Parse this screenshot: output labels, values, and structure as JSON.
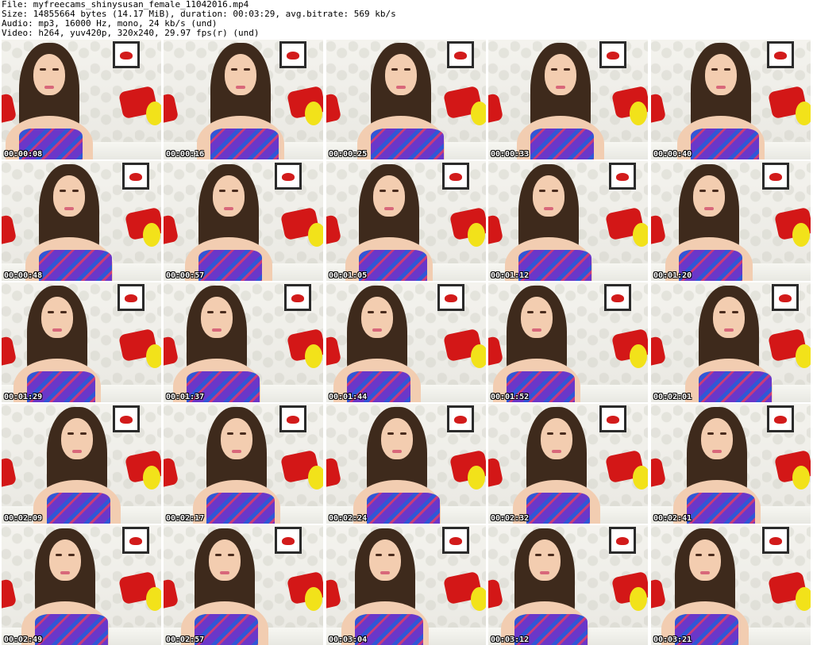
{
  "header": {
    "file": "File: myfreecams_shinysusan_female_11042016.mp4",
    "size": "Size: 14855664 bytes (14.17 MiB), duration: 00:03:29, avg.bitrate: 569 kb/s",
    "audio": "Audio: mp3, 16000 Hz, mono, 24 kb/s (und)",
    "video": "Video: h264, yuv420p, 320x240, 29.97 fps(r) (und)"
  },
  "thumbnails": [
    {
      "time": "00:00:08"
    },
    {
      "time": "00:00:16"
    },
    {
      "time": "00:00:25"
    },
    {
      "time": "00:00:33"
    },
    {
      "time": "00:00:40"
    },
    {
      "time": "00:00:48"
    },
    {
      "time": "00:00:57"
    },
    {
      "time": "00:01:05"
    },
    {
      "time": "00:01:12"
    },
    {
      "time": "00:01:20"
    },
    {
      "time": "00:01:29"
    },
    {
      "time": "00:01:37"
    },
    {
      "time": "00:01:44"
    },
    {
      "time": "00:01:52"
    },
    {
      "time": "00:02:01"
    },
    {
      "time": "00:02:09"
    },
    {
      "time": "00:02:17"
    },
    {
      "time": "00:02:24"
    },
    {
      "time": "00:02:32"
    },
    {
      "time": "00:02:41"
    },
    {
      "time": "00:02:49"
    },
    {
      "time": "00:02:57"
    },
    {
      "time": "00:03:04"
    },
    {
      "time": "00:03:12"
    },
    {
      "time": "00:03:21"
    }
  ]
}
